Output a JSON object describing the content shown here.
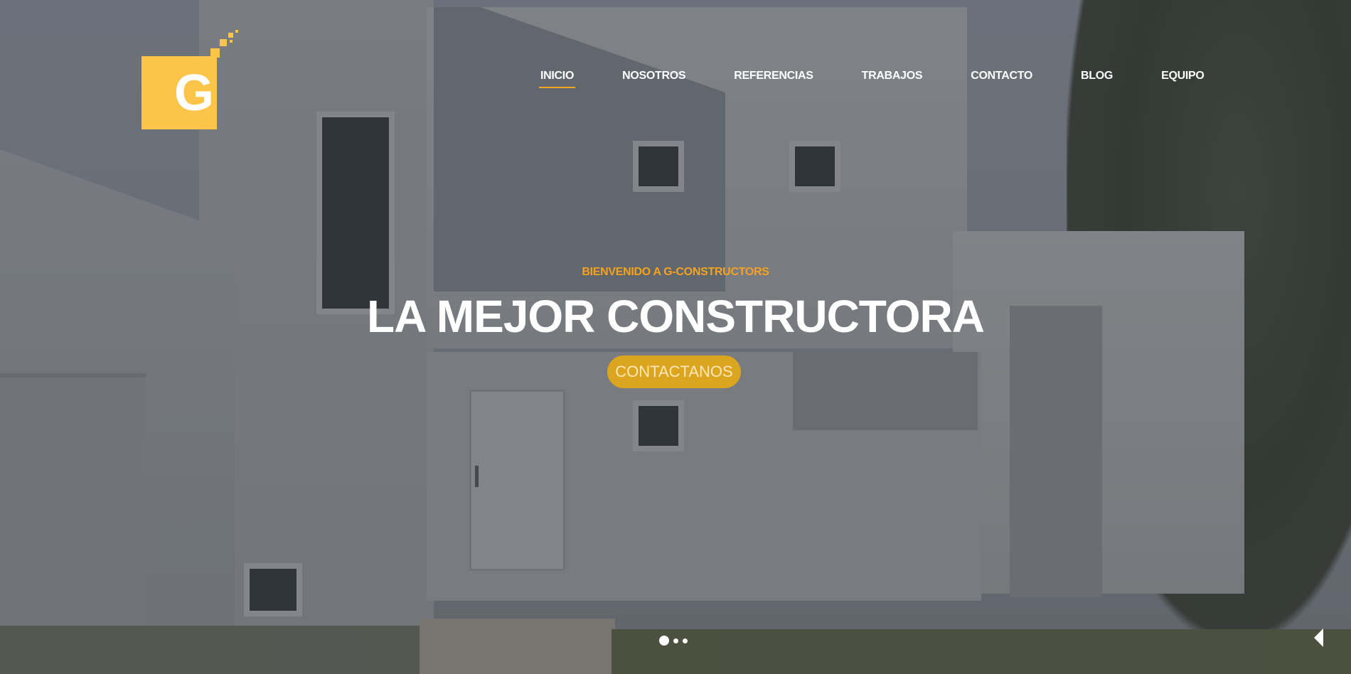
{
  "brand": {
    "logo_letter": "G"
  },
  "nav": {
    "items": [
      {
        "label": "INICIO",
        "active": true
      },
      {
        "label": "NOSOTROS",
        "active": false
      },
      {
        "label": "REFERENCIAS",
        "active": false
      },
      {
        "label": "TRABAJOS",
        "active": false
      },
      {
        "label": "CONTACTO",
        "active": false
      },
      {
        "label": "BLOG",
        "active": false
      },
      {
        "label": "EQUIPO",
        "active": false
      }
    ]
  },
  "hero": {
    "kicker": "BIENVENIDO A G-CONSTRUCTORS",
    "headline": "LA MEJOR CONSTRUCTORA",
    "cta_label": "CONTACTANOS"
  },
  "slider": {
    "slide_count": 3,
    "active_slide": 1,
    "prev_icon": "chevron-left-icon"
  },
  "colors": {
    "accent": "#f5a31f",
    "logo": "#fcc54a",
    "button": "#dba51f"
  }
}
